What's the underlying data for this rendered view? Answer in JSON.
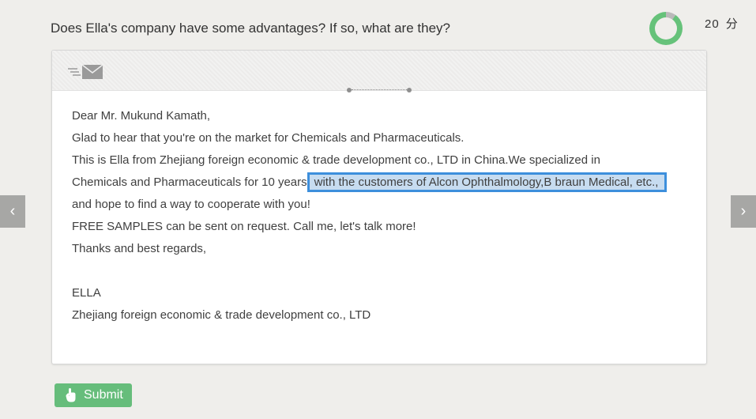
{
  "question": "Does Ella's company have some advantages? If so, what are they?",
  "score": {
    "value": "20",
    "unit": "分"
  },
  "timer": {
    "remaining_fraction": 0.9,
    "colors": {
      "remaining": "#66c27a",
      "elapsed": "#b9b9b9"
    }
  },
  "email": {
    "icon": "envelope-icon",
    "greeting": "Dear Mr. Mukund Kamath,",
    "line1": "Glad to hear that you're on the market for Chemicals and Pharmaceuticals.",
    "line2": "This is Ella from Zhejiang foreign economic & trade development co., LTD  in China.We specialized in",
    "line3_before": "Chemicals and Pharmaceuticals for 10 years",
    "line3_highlight": "with the customers of Alcon Ophthalmology,B braun Medical, etc.,",
    "line4": "and hope to find a way to cooperate with you!",
    "line5": "FREE SAMPLES can be sent on request. Call me, let's talk more!",
    "line6": "Thanks and best regards,",
    "signature_name": "ELLA",
    "signature_company": "Zhejiang foreign economic & trade development co., LTD"
  },
  "nav": {
    "prev_label": "‹",
    "next_label": "›"
  },
  "submit": {
    "label": "Submit",
    "icon": "hand-pointer-icon"
  },
  "colors": {
    "background": "#efeeeb",
    "accent_green": "#66bd7b",
    "highlight_fill": "#c7dcf0",
    "highlight_border": "#3d8fdc"
  }
}
